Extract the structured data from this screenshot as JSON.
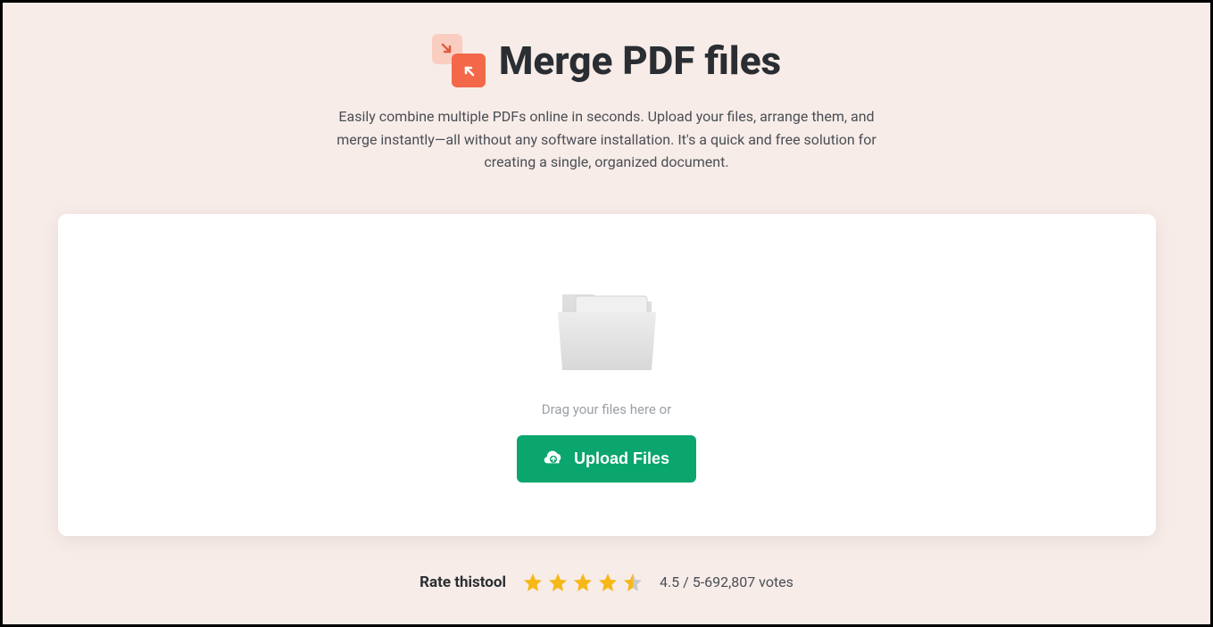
{
  "header": {
    "title": "Merge PDF files",
    "subtitle": "Easily combine multiple PDFs online in seconds. Upload your files, arrange them, and merge instantly—all without any software installation. It's a quick and free solution for creating a single, organized document."
  },
  "upload": {
    "drag_text": "Drag your files here or",
    "button_label": "Upload Files"
  },
  "rating": {
    "label": "Rate thistool",
    "score_text": "4.5 / 5-692,807 votes",
    "stars_full": 4,
    "stars_half": 1
  }
}
